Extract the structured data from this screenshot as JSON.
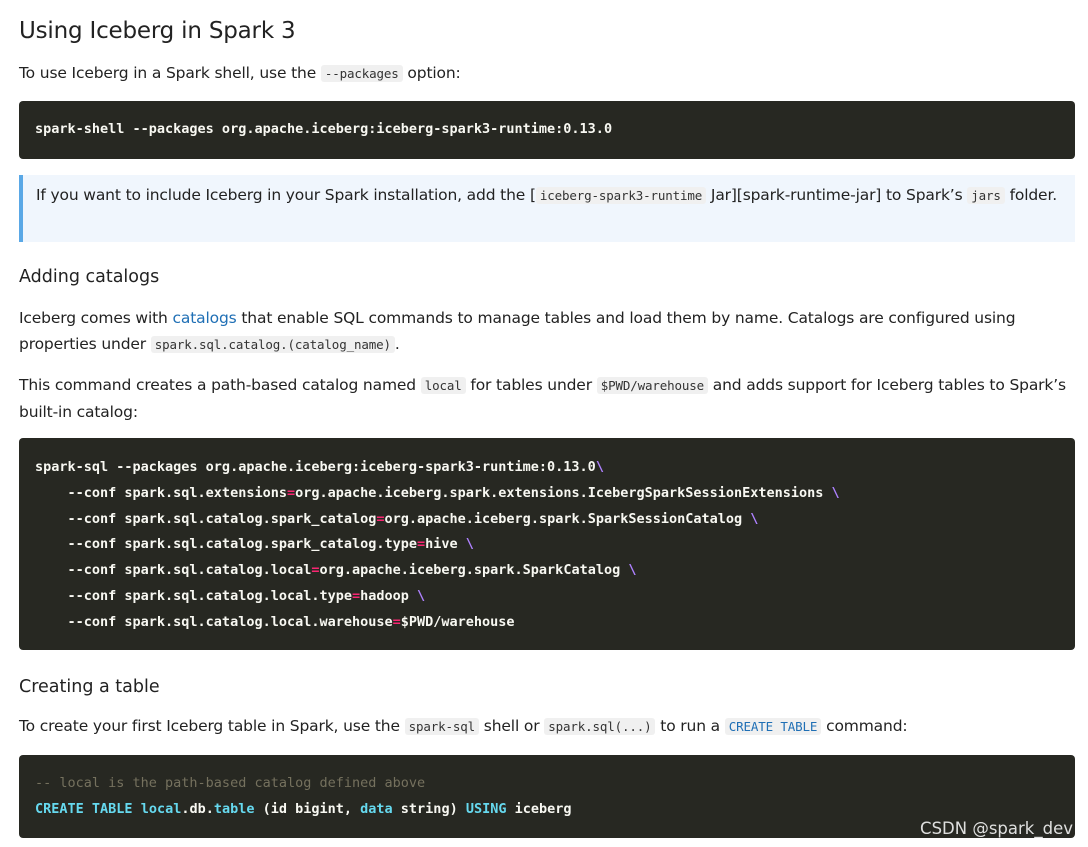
{
  "title": "Using Iceberg in Spark 3",
  "intro": {
    "before": "To use Iceberg in a Spark shell, use the ",
    "code": "--packages",
    "after": " option:"
  },
  "code_shell": "spark-shell --packages org.apache.iceberg:iceberg-spark3-runtime:0.13.0",
  "note": {
    "before": "If you want to include Iceberg in your Spark installation, add the [",
    "code1": "iceberg-spark3-runtime",
    "middle": " Jar][spark-runtime-jar] to Spark’s ",
    "code2": "jars",
    "after": " folder."
  },
  "section_catalogs": {
    "heading": "Adding catalogs",
    "p1_before": "Iceberg comes with ",
    "p1_link": "catalogs",
    "p1_after": " that enable SQL commands to manage tables and load them by name. Catalogs are configured using properties under ",
    "p1_code": "spark.sql.catalog.(catalog_name)",
    "p1_end": ".",
    "p2_before": "This command creates a path-based catalog named ",
    "p2_code1": "local",
    "p2_mid": " for tables under ",
    "p2_code2": "$PWD/warehouse",
    "p2_after": " and adds support for Iceberg tables to Spark’s built-in catalog:"
  },
  "code_sql": {
    "line1": "spark-sql --packages org.apache.iceberg:iceberg-spark3-runtime:0.13.0",
    "lines": [
      {
        "key": "    --conf spark.sql.extensions",
        "val": "org.apache.iceberg.spark.extensions.IcebergSparkSessionExtensions",
        "cont": true
      },
      {
        "key": "    --conf spark.sql.catalog.spark_catalog",
        "val": "org.apache.iceberg.spark.SparkSessionCatalog",
        "cont": true
      },
      {
        "key": "    --conf spark.sql.catalog.spark_catalog.type",
        "val": "hive",
        "cont": true
      },
      {
        "key": "    --conf spark.sql.catalog.local",
        "val": "org.apache.iceberg.spark.SparkCatalog",
        "cont": true
      },
      {
        "key": "    --conf spark.sql.catalog.local.type",
        "val": "hadoop",
        "cont": true
      },
      {
        "key": "    --conf spark.sql.catalog.local.warehouse",
        "val": "$PWD/warehouse",
        "cont": false
      }
    ]
  },
  "section_table": {
    "heading": "Creating a table",
    "p_before": "To create your first Iceberg table in Spark, use the ",
    "p_code1": "spark-sql",
    "p_mid1": " shell or ",
    "p_code2": "spark.sql(...)",
    "p_mid2": " to run a ",
    "p_code3": "CREATE TABLE",
    "p_after": " command:"
  },
  "code_create": {
    "comment": "-- local is the path-based catalog defined above",
    "kw1": "CREATE TABLE",
    "t1": "local",
    "t2": ".db.",
    "t3": "table",
    "t4": " (id bigint, ",
    "t5": "data",
    "t6": " string) ",
    "kw2": "USING",
    "t7": " iceberg"
  },
  "watermark": "CSDN @spark_dev",
  "colors": {
    "code_bg": "#272822",
    "note_border": "#5aa8e6",
    "note_bg": "#f0f6fd",
    "link": "#1f6fb5"
  }
}
